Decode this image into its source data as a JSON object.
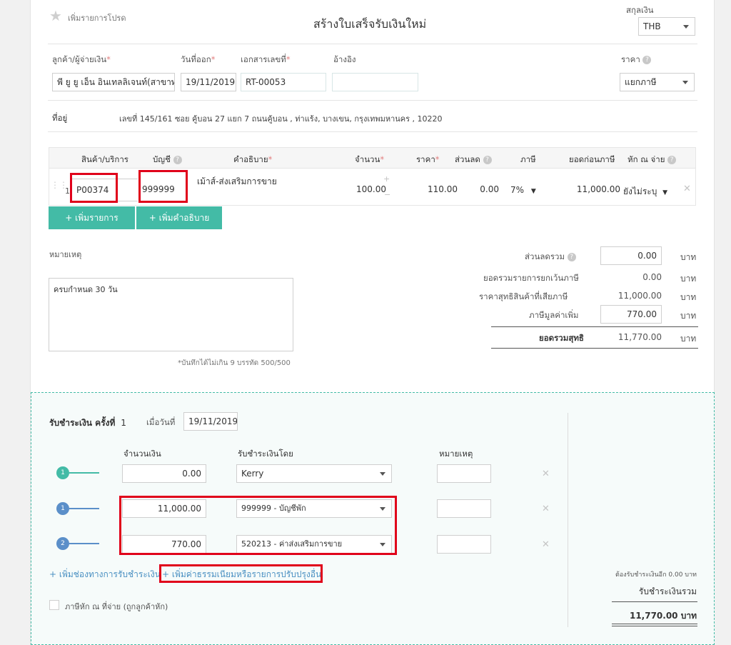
{
  "header": {
    "favorite_label": "เพิ่มรายการโปรด",
    "title": "สร้างใบเสร็จรับเงินใหม่",
    "currency_label": "สกุลเงิน",
    "currency_value": "THB"
  },
  "form": {
    "customer_label": "ลูกค้า/ผู้จ่ายเงิน",
    "customer_value": "พี ยู ยู เอ็น อินเทลลิเจนท์(สาขาท",
    "issue_date_label": "วันที่ออก",
    "issue_date_value": "19/11/2019",
    "doc_no_label": "เอกสารเลขที่",
    "doc_no_value": "RT-00053",
    "reference_label": "อ้างอิง",
    "reference_value": "",
    "price_label": "ราคา",
    "price_value": "แยกภาษี",
    "address_label": "ที่อยู่",
    "address_value": "เลขที่ 145/161 ซอย คู้บอน 27 แยก 7 ถนนคู้บอน , ท่าแร้ง, บางเขน, กรุงเทพมหานคร , 10220"
  },
  "table": {
    "headers": {
      "product": "สินค้า/บริการ",
      "account": "บัญชี",
      "description": "คำอธิบาย",
      "quantity": "จำนวน",
      "price": "ราคา",
      "discount": "ส่วนลด",
      "tax": "ภาษี",
      "subtotal": "ยอดก่อนภาษี",
      "withholding": "หัก ณ จ่าย"
    },
    "rows": [
      {
        "index": "1",
        "product": "P00374",
        "account": "999999",
        "description": "เม้าส์-ส่งเสริมการขาย",
        "quantity": "100.00",
        "price": "110.00",
        "discount": "0.00",
        "tax": "7%",
        "subtotal": "11,000.00",
        "withholding": "ยังไม่ระบุ"
      }
    ],
    "add_item_label": "+ เพิ่มรายการ",
    "add_desc_label": "+ เพิ่มคำอธิบาย"
  },
  "notes": {
    "label": "หมายเหตุ",
    "value": "ครบกำหนด 30 วัน",
    "hint": "*บันทึกได้ไม่เกิน 9 บรรทัด 500/500"
  },
  "summary": {
    "discount_total_label": "ส่วนลดรวม",
    "discount_total_value": "0.00",
    "exempt_label": "ยอดรวมรายการยกเว้นภาษี",
    "exempt_value": "0.00",
    "taxable_label": "ราคาสุทธิสินค้าที่เสียภาษี",
    "taxable_value": "11,000.00",
    "vat_label": "ภาษีมูลค่าเพิ่ม",
    "vat_value": "770.00",
    "net_label": "ยอดรวมสุทธิ",
    "net_value": "11,770.00",
    "unit": "บาท"
  },
  "payment": {
    "title": "รับชำระเงิน ครั้งที่",
    "number": "1",
    "date_label": "เมื่อวันที่",
    "date_value": "19/11/2019",
    "amount_header": "จำนวนเงิน",
    "method_header": "รับชำระเงินโดย",
    "note_header": "หมายเหตุ",
    "rows": [
      {
        "badge": "1",
        "amount": "0.00",
        "method": "Kerry",
        "note": "",
        "color": "#43bba6"
      },
      {
        "badge": "1",
        "amount": "11,000.00",
        "method": "999999 - บัญชีพัก",
        "note": "",
        "color": "#5b8fc9"
      },
      {
        "badge": "2",
        "amount": "770.00",
        "method": "520213 - ค่าส่งเสริมการขาย",
        "note": "",
        "color": "#5b8fc9"
      }
    ],
    "add_method_link": "+ เพิ่มช่องทางการรับชำระเงิน",
    "add_fee_link": "+ เพิ่มค่าธรรมเนียมหรือรายการปรับปรุงอื่น",
    "withholding_checkbox_label": "ภาษีหัก ณ ที่จ่าย (ถูกลูกค้าหัก)",
    "remaining_text": "ต้องรับชำระเงินอีก 0.00 บาท",
    "total_label": "รับชำระเงินรวม",
    "total_value": "11,770.00",
    "total_unit": "บาท"
  }
}
